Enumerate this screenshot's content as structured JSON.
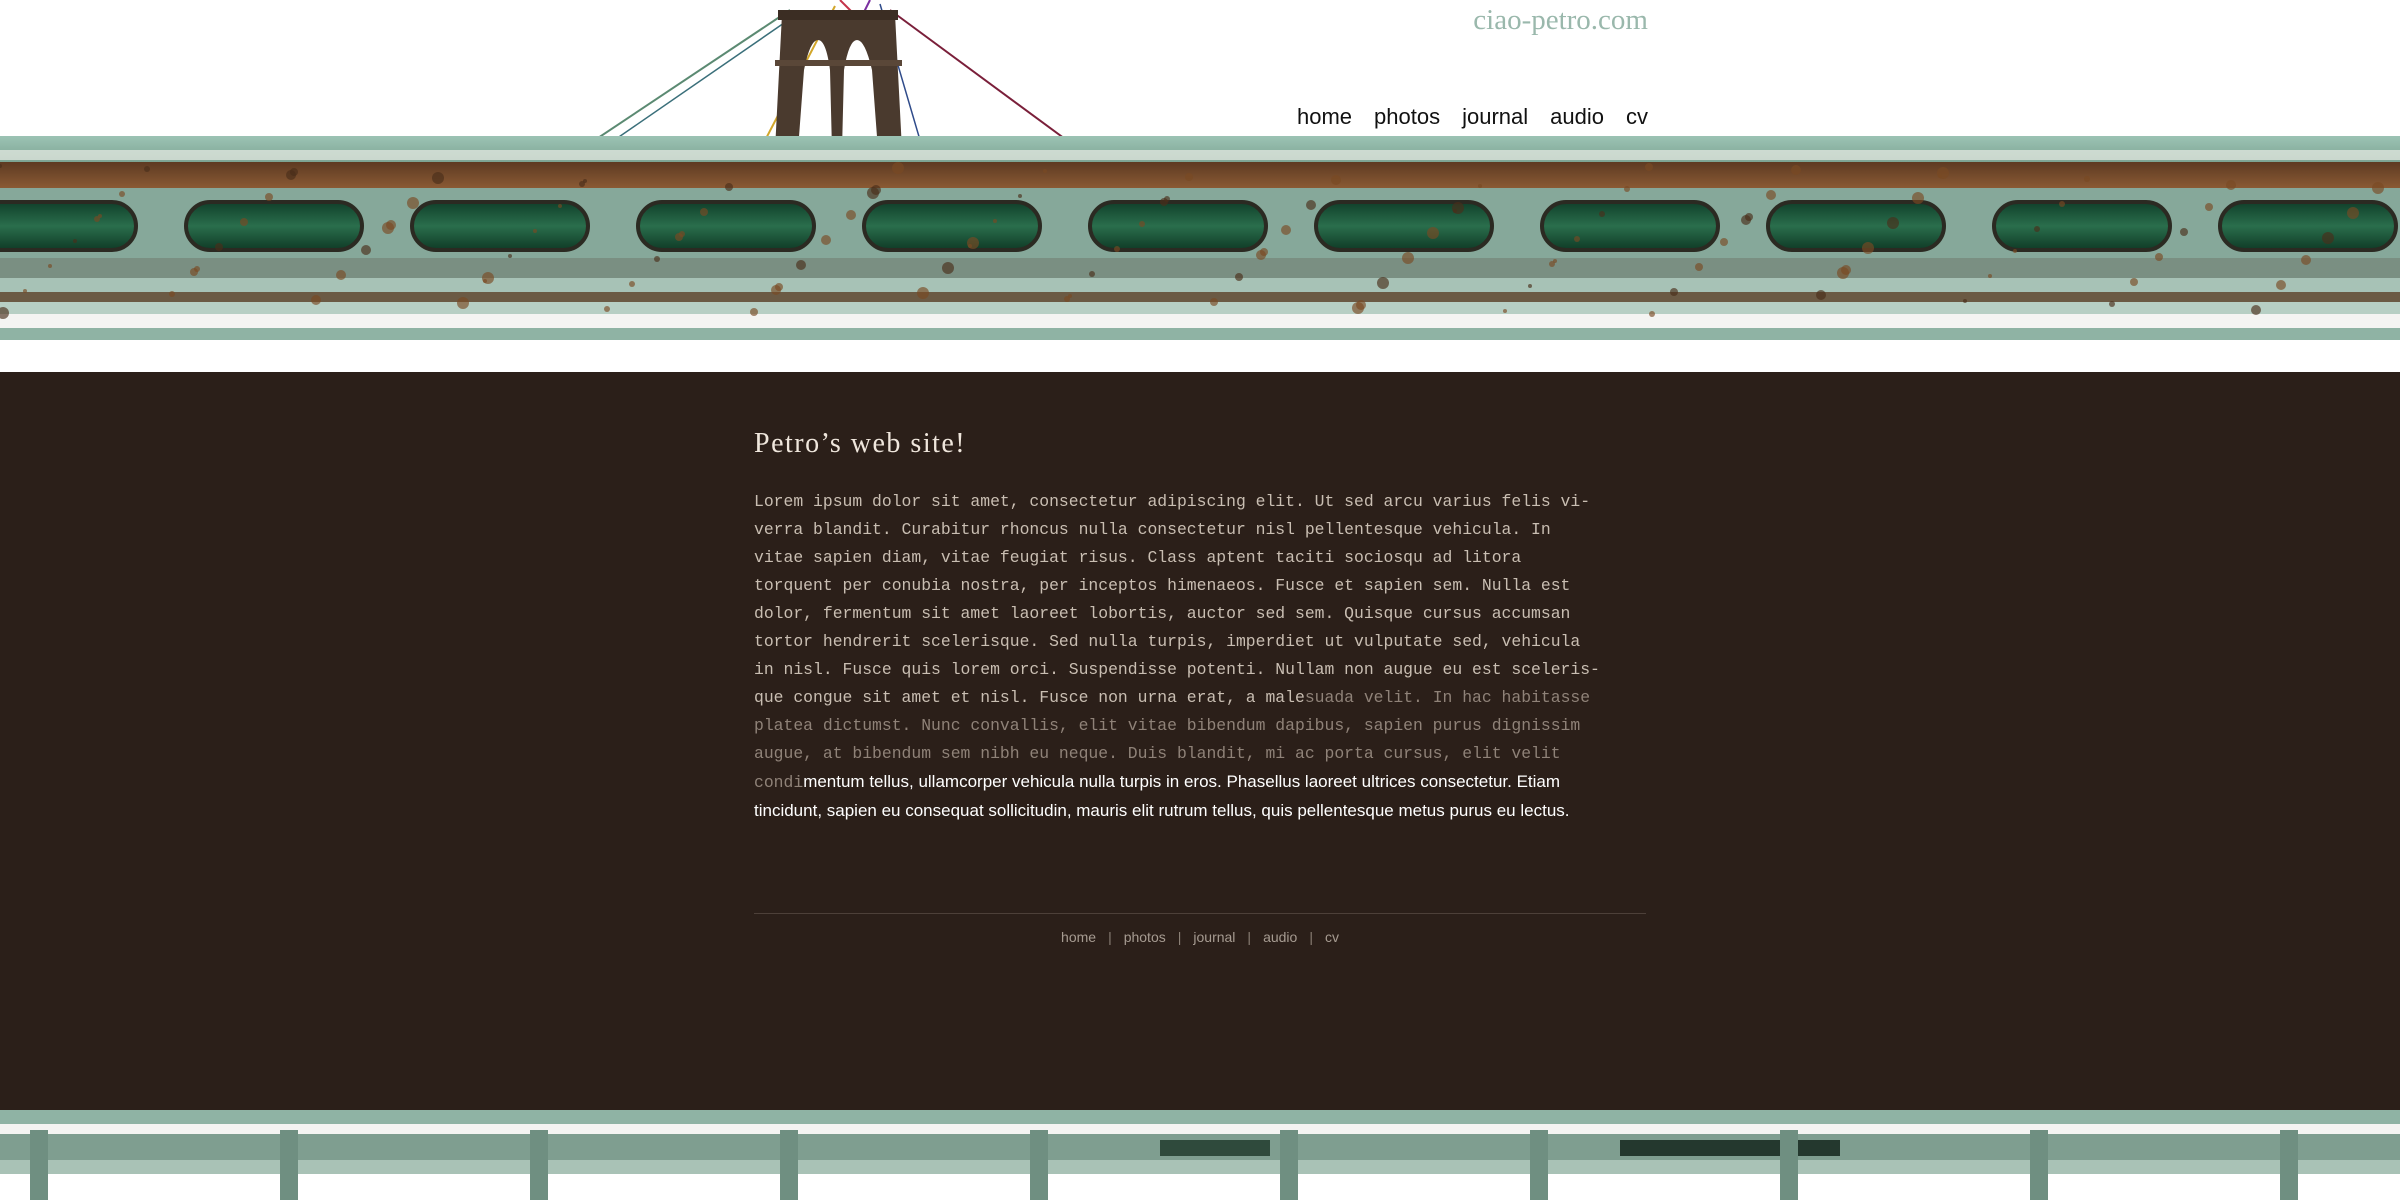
{
  "header": {
    "site_name": "ciao-petro.com",
    "nav": [
      "home",
      "photos",
      "journal",
      "audio",
      "cv"
    ]
  },
  "main": {
    "title": "Petro’s web site!",
    "paragraph_lines": [
      {
        "text": "Lorem ipsum dolor sit amet, consectetur adipiscing elit. Ut sed arcu varius felis vi-"
      },
      {
        "text": "verra blandit. Curabitur rhoncus nulla consectetur nisl pellentesque vehicula. In"
      },
      {
        "text": "vitae sapien diam, vitae feugiat risus. Class aptent taciti sociosqu ad litora"
      },
      {
        "text": "torquent per conubia nostra, per inceptos himenaeos. Fusce et sapien sem. Nulla est"
      },
      {
        "text": "dolor, fermentum sit amet laoreet lobortis, auctor sed sem. Quisque cursus accumsan"
      },
      {
        "text": "tortor hendrerit scelerisque. Sed nulla turpis, imperdiet ut vulputate sed, vehicula"
      },
      {
        "text": "in nisl. Fusce quis lorem orci. Suspendisse potenti. Nullam non augue eu est sceleris-"
      },
      {
        "text": "que congue sit amet et nisl. Fusce non urna erat, a male",
        "tail": "suada velit. In hac habitasse"
      },
      {
        "fade": "platea dictumst. Nunc convallis, elit vitae bibendum dapibus, sapien purus dignissim"
      },
      {
        "fade": "augue, at bibendum sem nibh eu neque. Duis blandit, mi ac porta cursus, elit velit"
      },
      {
        "fade": "condi",
        "sans": "mentum tellus, ullamcorper vehicula nulla turpis in eros. Phasellus laoreet ultrices consectetur. Etiam"
      },
      {
        "sans": "tincidunt, sapien eu consequat sollicitudin, mauris elit rutrum tellus, quis pellentesque metus purus eu lectus."
      }
    ]
  },
  "footer": {
    "nav": [
      "home",
      "photos",
      "journal",
      "audio",
      "cv"
    ],
    "separator": "|"
  },
  "colors": {
    "background_dark": "#2b1f19",
    "site_name": "#9ab8ac",
    "girder_teal": "#8fb3a4",
    "rust": "#6b3e1f",
    "window_green": "#1f5a3d"
  },
  "icons": [
    "bridge-tower-icon",
    "bridge-girder-image",
    "bottom-girder-image"
  ]
}
